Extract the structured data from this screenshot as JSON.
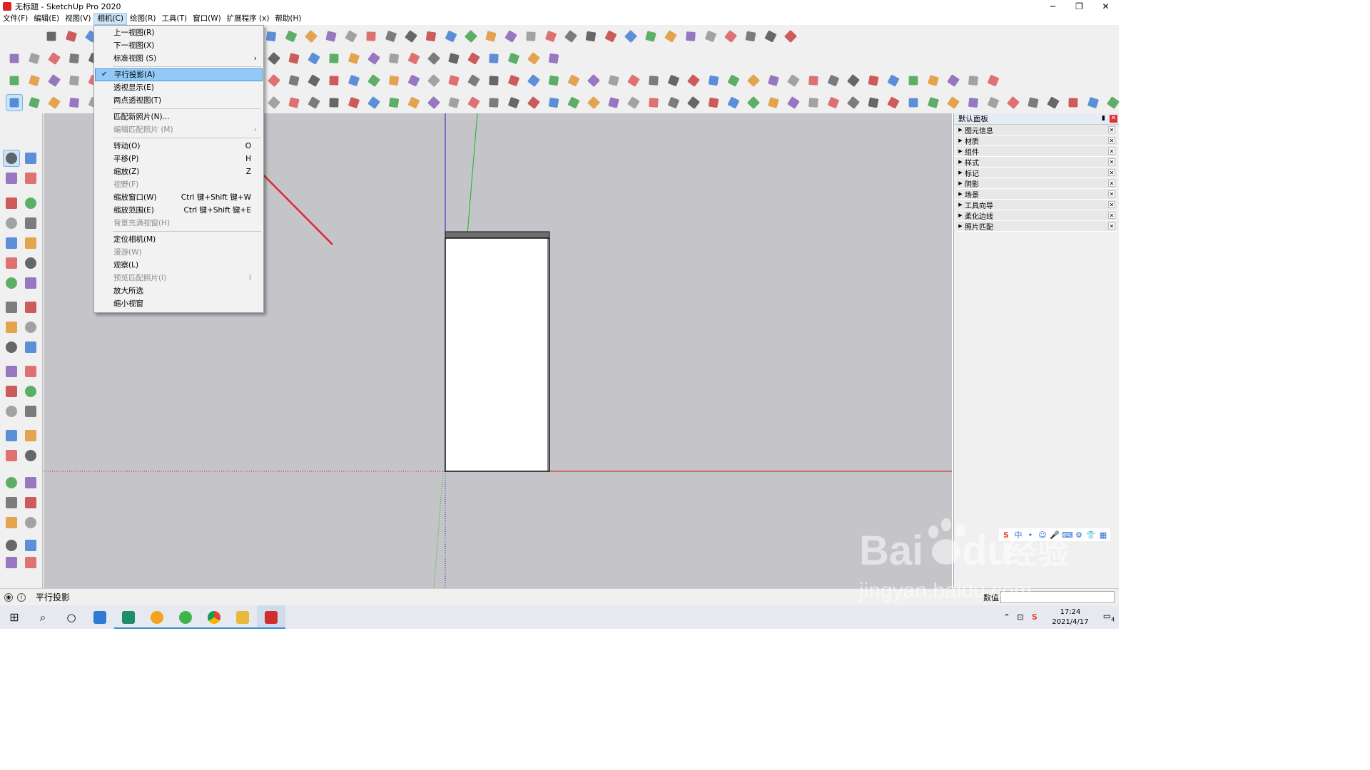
{
  "window": {
    "title": "无标题 - SketchUp Pro 2020",
    "min": "─",
    "max": "❐",
    "close": "✕"
  },
  "menubar": [
    {
      "label": "文件(F)"
    },
    {
      "label": "编辑(E)"
    },
    {
      "label": "视图(V)"
    },
    {
      "label": "相机(C)",
      "active": true
    },
    {
      "label": "绘图(R)"
    },
    {
      "label": "工具(T)"
    },
    {
      "label": "窗口(W)"
    },
    {
      "label": "扩展程序 (x)"
    },
    {
      "label": "帮助(H)"
    }
  ],
  "camera_menu": {
    "items": [
      {
        "label": "上一视图(R)",
        "shortcut": "",
        "state": "normal"
      },
      {
        "label": "下一视图(X)",
        "shortcut": "",
        "state": "normal"
      },
      {
        "label": "标准视图 (S)",
        "shortcut": "",
        "state": "submenu"
      },
      {
        "sep": true
      },
      {
        "label": "平行投影(A)",
        "shortcut": "",
        "state": "checked-highlight"
      },
      {
        "label": "透视显示(E)",
        "shortcut": "",
        "state": "normal"
      },
      {
        "label": "两点透视图(T)",
        "shortcut": "",
        "state": "normal"
      },
      {
        "sep": true
      },
      {
        "label": "匹配新照片(N)...",
        "shortcut": "",
        "state": "normal"
      },
      {
        "label": "编辑匹配照片 (M)",
        "shortcut": "",
        "state": "disabled-submenu"
      },
      {
        "sep": true
      },
      {
        "label": "转动(O)",
        "shortcut": "O",
        "state": "normal"
      },
      {
        "label": "平移(P)",
        "shortcut": "H",
        "state": "normal"
      },
      {
        "label": "缩放(Z)",
        "shortcut": "Z",
        "state": "normal"
      },
      {
        "label": "视野(F)",
        "shortcut": "",
        "state": "disabled"
      },
      {
        "label": "缩放窗口(W)",
        "shortcut": "Ctrl 键+Shift 键+W",
        "state": "normal"
      },
      {
        "label": "缩放范围(E)",
        "shortcut": "Ctrl 键+Shift 键+E",
        "state": "normal"
      },
      {
        "label": "背景充满视窗(H)",
        "shortcut": "",
        "state": "disabled"
      },
      {
        "sep": true
      },
      {
        "label": "定位相机(M)",
        "shortcut": "",
        "state": "normal"
      },
      {
        "label": "漫游(W)",
        "shortcut": "",
        "state": "disabled"
      },
      {
        "label": "观察(L)",
        "shortcut": "",
        "state": "normal"
      },
      {
        "label": "预览匹配照片(I)",
        "shortcut": "I",
        "state": "disabled"
      },
      {
        "label": "放大所选",
        "shortcut": "",
        "state": "normal"
      },
      {
        "label": "缩小视窗",
        "shortcut": "",
        "state": "normal"
      }
    ]
  },
  "tray": {
    "title": "默认面板",
    "panels": [
      "图元信息",
      "材质",
      "组件",
      "样式",
      "标记",
      "阴影",
      "场景",
      "工具向导",
      "柔化边线",
      "照片匹配"
    ]
  },
  "status": {
    "text": "平行投影",
    "vcb_label": "数值",
    "vcb_value": ""
  },
  "taskbar": {
    "time": "17:24",
    "date": "2021/4/17",
    "notif_count": "4"
  },
  "ime": [
    "S",
    "中",
    "•",
    "☺",
    "🎤",
    "⌨",
    "⚙",
    "👕",
    "▦"
  ],
  "colors": {
    "accent": "#91c9f7",
    "viewport_bg": "#c4c4c9",
    "axis_red": "#d81818",
    "axis_green": "#1ab81a",
    "axis_blue": "#2020c8",
    "arrow_red": "#e0282c"
  },
  "watermark": {
    "brand": "Bai",
    "paw": "du",
    "cn": "经验",
    "url": "jingyan.baidu.com"
  }
}
